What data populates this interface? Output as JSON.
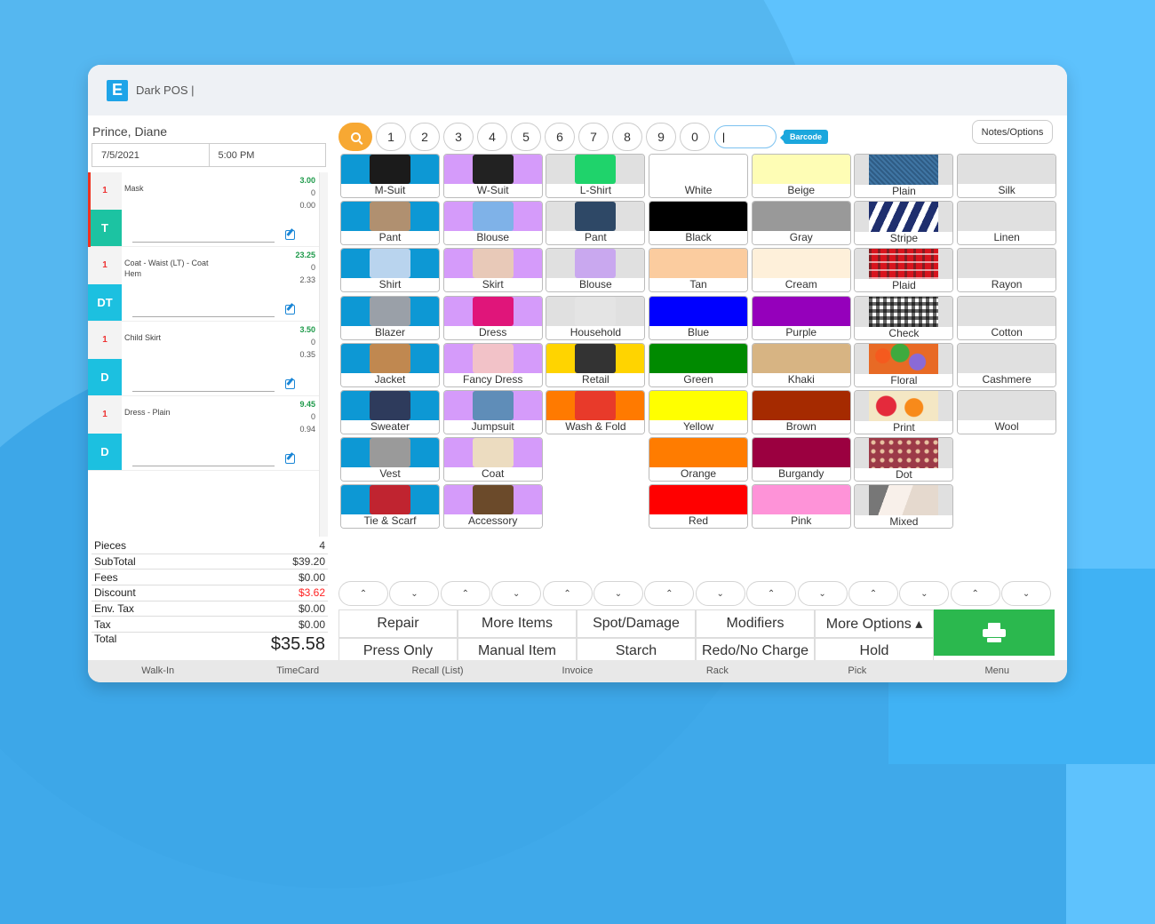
{
  "app": {
    "title": "Dark POS |",
    "logo_letter": "E"
  },
  "customer": {
    "name": "Prince, Diane",
    "date": "7/5/2021",
    "time": "5:00 PM"
  },
  "order_items": [
    {
      "qty": "1",
      "code": "T",
      "code_color": "#1cc3a2",
      "description": "Mask",
      "price": "3.00",
      "mid": "0",
      "tax": "0.00",
      "flagged": true
    },
    {
      "qty": "1",
      "code": "DT",
      "code_color": "#1cc0e0",
      "description": "Coat - Waist (LT) - Coat Hem",
      "price": "23.25",
      "mid": "0",
      "tax": "2.33",
      "flagged": false
    },
    {
      "qty": "1",
      "code": "D",
      "code_color": "#1cc0e0",
      "description": "Child Skirt",
      "price": "3.50",
      "mid": "0",
      "tax": "0.35",
      "flagged": false
    },
    {
      "qty": "1",
      "code": "D",
      "code_color": "#1cc0e0",
      "description": "Dress - Plain",
      "price": "9.45",
      "mid": "0",
      "tax": "0.94",
      "flagged": false
    }
  ],
  "totals": {
    "pieces": {
      "label": "Pieces",
      "value": "4"
    },
    "subtotal": {
      "label": "SubTotal",
      "value": "$39.20"
    },
    "fees": {
      "label": "Fees",
      "value": "$0.00"
    },
    "discount": {
      "label": "Discount",
      "value": "$3.62"
    },
    "env_tax": {
      "label": "Env. Tax",
      "value": "$0.00"
    },
    "tax": {
      "label": "Tax",
      "value": "$0.00"
    },
    "total": {
      "label": "Total",
      "value": "$35.58"
    }
  },
  "keypad": {
    "keys": [
      "1",
      "2",
      "3",
      "4",
      "5",
      "6",
      "7",
      "8",
      "9",
      "0"
    ],
    "barcode_value": "|",
    "barcode_label": "Barcode",
    "notes_label": "Notes/Options"
  },
  "grid_columns": [
    {
      "name": "men",
      "bg": "#0d98d4",
      "items": [
        "M-Suit",
        "Pant",
        "Shirt",
        "Blazer",
        "Jacket",
        "Sweater",
        "Vest",
        "Tie & Scarf"
      ],
      "swatches": [
        "#1b1b1b",
        "#b09070",
        "#b9d4ee",
        "#9aa0a8",
        "#c08850",
        "#2e3b5c",
        "#9a9a9a",
        "#c02430"
      ]
    },
    {
      "name": "women",
      "bg": "#d59bfa",
      "items": [
        "W-Suit",
        "Blouse",
        "Skirt",
        "Dress",
        "Fancy Dress",
        "Jumpsuit",
        "Coat",
        "Accessory"
      ],
      "swatches": [
        "#222222",
        "#7fb2e8",
        "#e8c9b8",
        "#e0157a",
        "#f2c2c8",
        "#5f8db8",
        "#ecdcc0",
        "#6b4a2a"
      ]
    },
    {
      "name": "other",
      "bg": "#e0e0e0",
      "items": [
        "L-Shirt",
        "Pant",
        "Blouse",
        "Household",
        "Retail",
        "Wash & Fold"
      ],
      "bgs": [
        "#e0e0e0",
        "#e0e0e0",
        "#e0e0e0",
        "#e0e0e0",
        "#ffd400",
        "#ff7a00"
      ],
      "swatches": [
        "#1fd36b",
        "#2e4866",
        "#c9a8ef",
        "#e4e4e4",
        "#333333",
        "#e83a2a"
      ]
    },
    {
      "name": "colors-1",
      "items": [
        "White",
        "Black",
        "Tan",
        "Blue",
        "Green",
        "Yellow",
        "Orange",
        "Red"
      ],
      "colors": [
        "#ffffff",
        "#000000",
        "#fbcc9f",
        "#0000ff",
        "#008a00",
        "#ffff00",
        "#ff7c00",
        "#ff0000"
      ]
    },
    {
      "name": "colors-2",
      "items": [
        "Beige",
        "Gray",
        "Cream",
        "Purple",
        "Khaki",
        "Brown",
        "Burgandy",
        "Pink"
      ],
      "colors": [
        "#fefdb5",
        "#999999",
        "#fef0da",
        "#9500bb",
        "#d7b483",
        "#a52a00",
        "#9b0040",
        "#fe93d8"
      ]
    },
    {
      "name": "patterns",
      "items": [
        "Plain",
        "Stripe",
        "Plaid",
        "Check",
        "Floral",
        "Print",
        "Dot",
        "Mixed"
      ],
      "patterns": [
        "denim",
        "stripe",
        "plaid",
        "check",
        "floral",
        "print",
        "dot",
        "mixed"
      ]
    },
    {
      "name": "fabrics",
      "items": [
        "Silk",
        "Linen",
        "Rayon",
        "Cotton",
        "Cashmere",
        "Wool"
      ]
    }
  ],
  "arrow_pairs": 7,
  "arrow_up": "^",
  "arrow_down": "v",
  "actions": {
    "row1": [
      "Repair",
      "More Items",
      "Spot/Damage",
      "Modifiers",
      "More Options ▴"
    ],
    "row2": [
      "Press Only",
      "Manual Item",
      "Starch",
      "Redo/No Charge",
      "Hold"
    ],
    "print_color": "#2bb84e"
  },
  "bottom_nav": [
    "Walk-In",
    "TimeCard",
    "Recall (List)",
    "Invoice",
    "Rack",
    "Pick",
    "Menu"
  ]
}
